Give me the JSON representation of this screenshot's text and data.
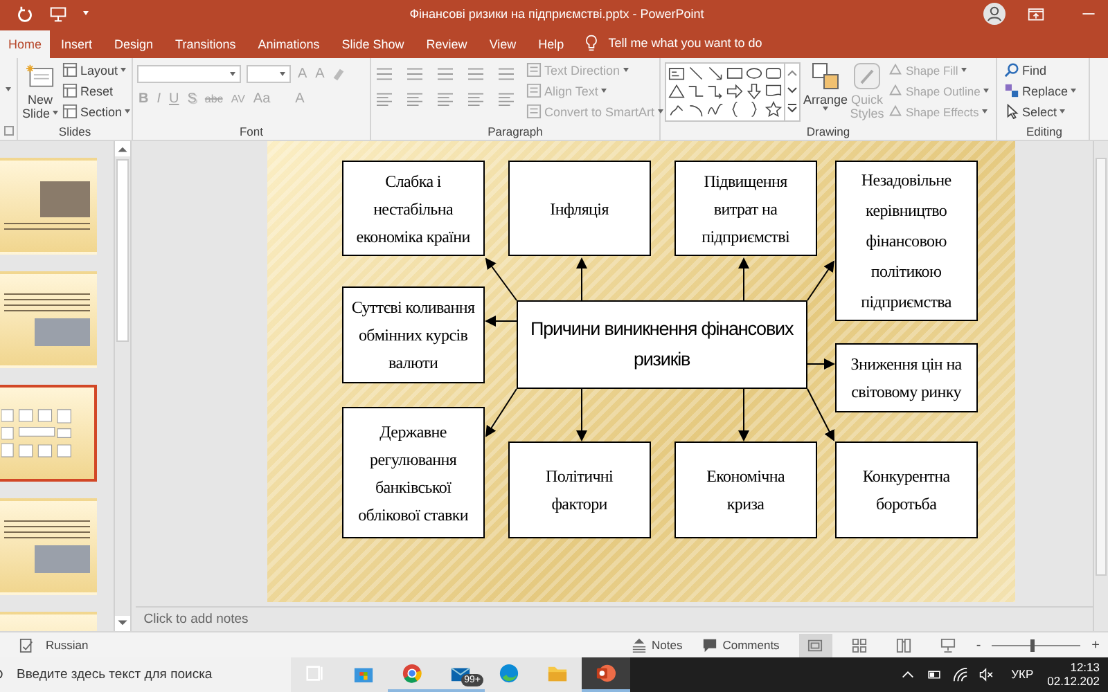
{
  "title_bar": {
    "title": "Фінансові ризики на підприємстві.pptx  -  PowerPoint"
  },
  "tabs": [
    {
      "label": "Home",
      "selected": true
    },
    {
      "label": "Insert",
      "selected": false
    },
    {
      "label": "Design",
      "selected": false
    },
    {
      "label": "Transitions",
      "selected": false
    },
    {
      "label": "Animations",
      "selected": false
    },
    {
      "label": "Slide Show",
      "selected": false
    },
    {
      "label": "Review",
      "selected": false
    },
    {
      "label": "View",
      "selected": false
    },
    {
      "label": "Help",
      "selected": false
    }
  ],
  "tell_me": "Tell me what you want to do",
  "ribbon": {
    "slides": {
      "label": "Slides",
      "new_slide": [
        "New",
        "Slide"
      ],
      "commands": [
        "Layout",
        "Reset",
        "Section"
      ]
    },
    "font": {
      "label": "Font",
      "disabled": true,
      "size_buttons": [
        "A",
        "A"
      ],
      "buttons": [
        "B",
        "I",
        "U",
        "S",
        "abc",
        "AV",
        "Aa",
        "A"
      ]
    },
    "paragraph": {
      "label": "Paragraph",
      "commands": [
        {
          "label": "Text Direction",
          "disabled": true
        },
        {
          "label": "Align Text",
          "disabled": true
        },
        {
          "label": "Convert to SmartArt",
          "disabled": true
        }
      ]
    },
    "drawing": {
      "label": "Drawing",
      "arrange": "Arrange",
      "quick_styles": {
        "lines": [
          "Quick",
          "Styles"
        ],
        "disabled": true
      },
      "commands": [
        {
          "label": "Shape Fill",
          "disabled": true
        },
        {
          "label": "Shape Outline",
          "disabled": true
        },
        {
          "label": "Shape Effects",
          "disabled": true
        }
      ]
    },
    "editing": {
      "label": "Editing",
      "commands": [
        {
          "label": "Find",
          "kind": "find"
        },
        {
          "label": "Replace",
          "kind": "replace"
        },
        {
          "label": "Select",
          "kind": "select"
        }
      ]
    }
  },
  "thumbnails": [
    {
      "kind": "photo-title",
      "selected": false
    },
    {
      "kind": "text-photo",
      "selected": false
    },
    {
      "kind": "diagram",
      "selected": true
    },
    {
      "kind": "text-photo",
      "selected": false
    },
    {
      "kind": "partial",
      "selected": false
    }
  ],
  "slide": {
    "center": "Причини виникнення фінансових ризиків",
    "nodes": [
      "Слабка і нестабільна економіка країни",
      "Інфляція",
      "Підвищення витрат на підприємстві",
      "Незадовільне керівництво фінансовою політикою підприємства",
      "Суттєві коливання обмінних курсів валюти",
      "Зниження цін на світовому ринку",
      "Державне регулювання банківської облікової ставки",
      "Політичні фактори",
      "Економічна криза",
      "Конкурентна боротьба"
    ]
  },
  "notes": {
    "placeholder": "Click to add notes"
  },
  "status_bar": {
    "language": "Russian",
    "notes": "Notes",
    "comments": "Comments",
    "views": [
      {
        "selected": true
      },
      {
        "selected": false
      },
      {
        "selected": false
      },
      {
        "selected": false
      }
    ],
    "zoom": {
      "minus": "-",
      "plus": "+",
      "level": 0.45
    }
  },
  "taskbar": {
    "search": {
      "placeholder": "Введите здесь текст для поиска"
    },
    "apps": [
      {
        "kind": "task-view",
        "running": false,
        "selected": false
      },
      {
        "kind": "store",
        "running": false,
        "selected": false
      },
      {
        "kind": "chrome",
        "running": true,
        "selected": false
      },
      {
        "kind": "mail",
        "running": true,
        "selected": false,
        "badge": "99+"
      },
      {
        "kind": "edge",
        "running": false,
        "selected": false
      },
      {
        "kind": "folder",
        "running": false,
        "selected": false
      },
      {
        "kind": "powerpoint",
        "running": true,
        "selected": true
      }
    ],
    "language": "УКР",
    "time": "12:13",
    "date": "02.12.202"
  }
}
